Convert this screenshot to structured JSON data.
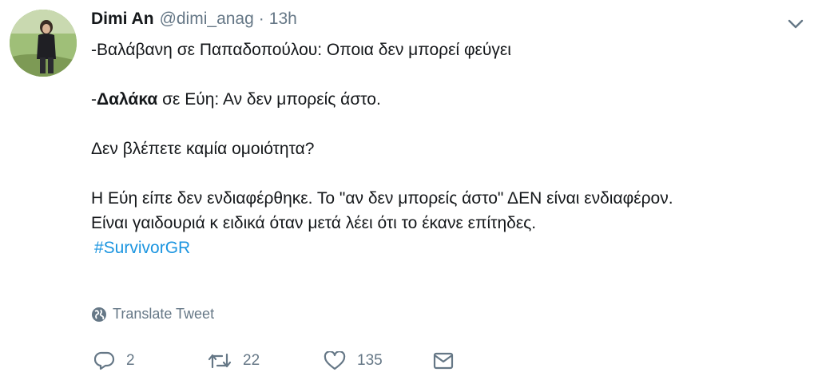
{
  "tweet": {
    "display_name": "Dimi An",
    "handle": "@dimi_anag",
    "separator": "·",
    "time": "13h",
    "lines": {
      "l1": "-Βαλάβανη σε Παπαδοπούλου: Οποια δεν μπορεί φεύγει",
      "l2_prefix": "-",
      "l2_bold": "Δαλάκα",
      "l2_rest": " σε Εύη: Αν δεν μπορείς άστο.",
      "l3": "Δεν βλέπετε καμία ομοιότητα?",
      "l4": "Η Εύη είπε δεν ενδιαφέρθηκε. Το \"αν δεν μπορείς άστο\" ΔΕΝ είναι ενδιαφέρον.",
      "l5": "Είναι γαιδουριά κ ειδικά όταν μετά λέει ότι το έκανε επίτηδες."
    },
    "hashtag": "#SurvivorGR",
    "translate_label": "Translate Tweet",
    "counts": {
      "replies": "2",
      "retweets": "22",
      "likes": "135"
    }
  },
  "colors": {
    "text": "#14171a",
    "secondary": "#657786",
    "link": "#1b95e0"
  },
  "icons": [
    "chevron-down-icon",
    "globe-icon",
    "reply-icon",
    "retweet-icon",
    "heart-icon",
    "envelope-icon"
  ]
}
